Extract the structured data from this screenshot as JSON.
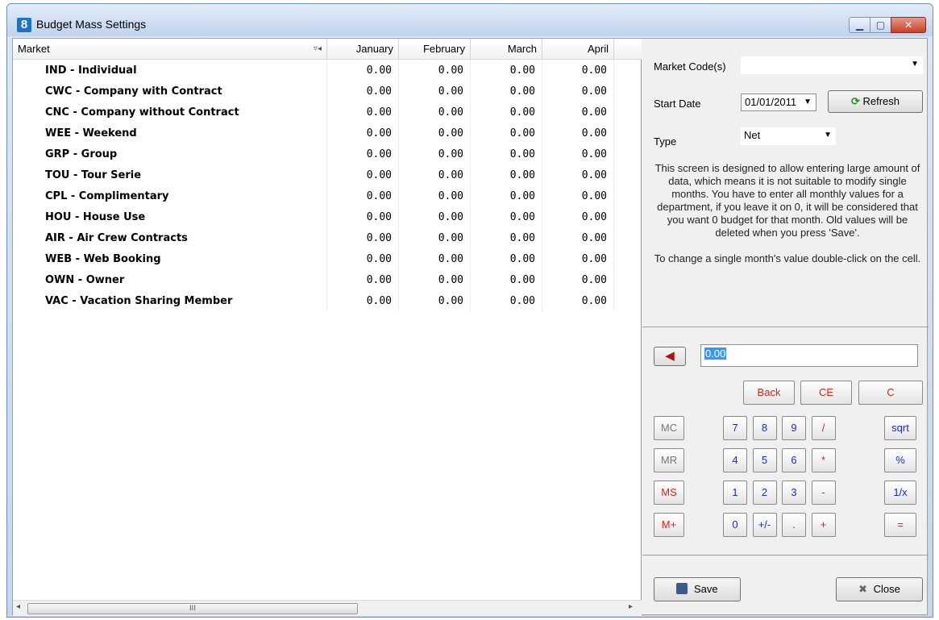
{
  "window": {
    "title": "Budget Mass Settings",
    "app_icon": "8",
    "buttons": {
      "minimize": "▁",
      "maximize": "▢",
      "close": "✕"
    }
  },
  "grid": {
    "columns": [
      "Market",
      "January",
      "February",
      "March",
      "April"
    ],
    "sort_indicator": "▿◂",
    "rows": [
      {
        "market": "IND - Individual",
        "jan": "0.00",
        "feb": "0.00",
        "mar": "0.00",
        "apr": "0.00"
      },
      {
        "market": "CWC - Company with Contract",
        "jan": "0.00",
        "feb": "0.00",
        "mar": "0.00",
        "apr": "0.00"
      },
      {
        "market": "CNC - Company without Contract",
        "jan": "0.00",
        "feb": "0.00",
        "mar": "0.00",
        "apr": "0.00"
      },
      {
        "market": "WEE - Weekend",
        "jan": "0.00",
        "feb": "0.00",
        "mar": "0.00",
        "apr": "0.00"
      },
      {
        "market": "GRP - Group",
        "jan": "0.00",
        "feb": "0.00",
        "mar": "0.00",
        "apr": "0.00"
      },
      {
        "market": "TOU - Tour Serie",
        "jan": "0.00",
        "feb": "0.00",
        "mar": "0.00",
        "apr": "0.00"
      },
      {
        "market": "CPL - Complimentary",
        "jan": "0.00",
        "feb": "0.00",
        "mar": "0.00",
        "apr": "0.00"
      },
      {
        "market": "HOU - House Use",
        "jan": "0.00",
        "feb": "0.00",
        "mar": "0.00",
        "apr": "0.00"
      },
      {
        "market": "AIR - Air Crew Contracts",
        "jan": "0.00",
        "feb": "0.00",
        "mar": "0.00",
        "apr": "0.00"
      },
      {
        "market": "WEB - Web Booking",
        "jan": "0.00",
        "feb": "0.00",
        "mar": "0.00",
        "apr": "0.00"
      },
      {
        "market": "OWN - Owner",
        "jan": "0.00",
        "feb": "0.00",
        "mar": "0.00",
        "apr": "0.00"
      },
      {
        "market": "VAC - Vacation Sharing Member",
        "jan": "0.00",
        "feb": "0.00",
        "mar": "0.00",
        "apr": "0.00"
      }
    ],
    "scroll": {
      "left_arrow": "◂",
      "right_arrow": "▸",
      "thumb_grip": "III"
    }
  },
  "filters": {
    "market_code_label": "Market Code(s)",
    "market_code_value": "",
    "start_date_label": "Start Date",
    "start_date_value": "01/01/2011",
    "refresh_label": "Refresh",
    "type_label": "Type",
    "type_value": "Net",
    "dropdown_glyph": "▼"
  },
  "info": {
    "paragraph1": "This screen is designed to allow entering large amount of data, which means it is not suitable to modify single months. You have to enter all monthly values for a department, if you leave it on 0, it will be considered that you want 0 budget for that month. Old values will be deleted when you press 'Save'.",
    "paragraph2": "To change a single month's value double-click on the cell."
  },
  "calculator": {
    "display_value": "0.00",
    "back_arrow": "◀",
    "top_row": [
      "Back",
      "CE",
      "C"
    ],
    "rows": [
      [
        "MC",
        "7",
        "8",
        "9",
        "/",
        "sqrt"
      ],
      [
        "MR",
        "4",
        "5",
        "6",
        "*",
        "%"
      ],
      [
        "MS",
        "1",
        "2",
        "3",
        "-",
        "1/x"
      ],
      [
        "M+",
        "0",
        "+/-",
        ".",
        "+",
        "="
      ]
    ]
  },
  "footer": {
    "save_label": "Save",
    "close_label": "Close"
  }
}
